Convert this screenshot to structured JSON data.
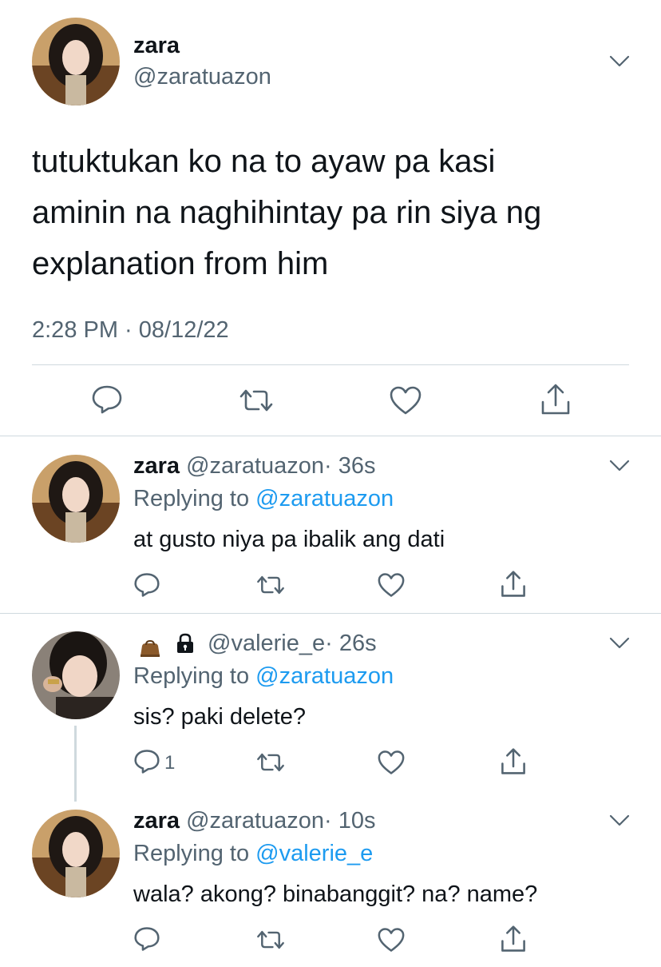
{
  "main_tweet": {
    "display_name": "zara",
    "handle": "@zaratuazon",
    "text_lines": [
      "tutuktukan ko na to ayaw pa kasi",
      "aminin na naghihintay pa rin siya ng",
      "explanation from him"
    ],
    "timestamp": "2:28 PM · 08/12/22",
    "actions": [
      "reply-icon",
      "retweet-icon",
      "like-icon",
      "share-icon"
    ]
  },
  "replies": [
    {
      "display_name": "zara",
      "handle": "@zaratuazon",
      "time": "· 36s",
      "replying_label": "Replying to",
      "replying_to": "@zaratuazon",
      "text": "at gusto niya pa ibalik ang dati",
      "reply_count": ""
    },
    {
      "display_name": "",
      "name_icons": [
        "bag-emoji",
        "lock-icon"
      ],
      "handle": "@valerie_e",
      "time": "· 26s",
      "replying_label": "Replying to",
      "replying_to": "@zaratuazon",
      "text": "sis? paki delete?",
      "reply_count": "1"
    },
    {
      "display_name": "zara",
      "handle": "@zaratuazon",
      "time": "· 10s",
      "replying_label": "Replying to",
      "replying_to": "@valerie_e",
      "text": "wala? akong? binabanggit? na? name?",
      "reply_count": ""
    }
  ],
  "colors": {
    "text": "#0f1419",
    "secondary": "#536471",
    "link": "#1d9bf0",
    "divider": "#cfd9de"
  }
}
